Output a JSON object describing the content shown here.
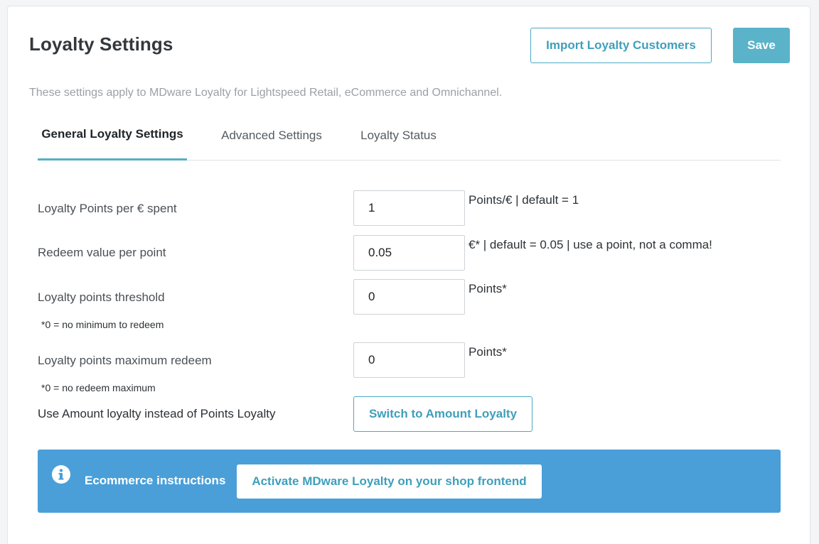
{
  "header": {
    "title": "Loyalty Settings",
    "import_label": "Import Loyalty Customers",
    "save_label": "Save",
    "subtitle": "These settings apply to MDware Loyalty for Lightspeed Retail, eCommerce and Omnichannel."
  },
  "tabs": [
    {
      "label": "General Loyalty Settings",
      "active": true
    },
    {
      "label": "Advanced Settings",
      "active": false
    },
    {
      "label": "Loyalty Status",
      "active": false
    }
  ],
  "fields": [
    {
      "label": "Loyalty Points per € spent",
      "value": "1",
      "hint": "Points/€ | default = 1"
    },
    {
      "label": "Redeem value per point",
      "value": "0.05",
      "hint": "€* | default = 0.05 | use a point, not a comma!"
    },
    {
      "label": "Loyalty points threshold",
      "value": "0",
      "hint": "Points*",
      "note": "*0 = no minimum to redeem"
    },
    {
      "label": "Loyalty points maximum redeem",
      "value": "0",
      "hint": "Points*",
      "note": "*0 = no redeem maximum"
    }
  ],
  "amount_loyalty": {
    "label": "Use Amount loyalty instead of Points Loyalty",
    "button_label": "Switch to Amount Loyalty"
  },
  "banner": {
    "icon": "info-icon",
    "label": "Ecommerce instructions",
    "button_label": "Activate MDware Loyalty on your shop frontend",
    "color": "#4a9fd8"
  },
  "colors": {
    "accent": "#4aa9c3",
    "save_bg": "#5ab3c8",
    "tab_underline": "#56b0c6"
  }
}
